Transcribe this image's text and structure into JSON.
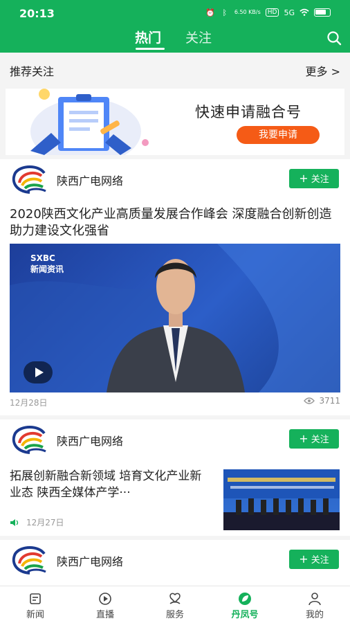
{
  "status_bar": {
    "time": "20:13",
    "speed": "6.50 KB/s",
    "network": "5G",
    "hd": "HD"
  },
  "header": {
    "tabs": [
      "热门",
      "关注"
    ],
    "active_tab": "热门"
  },
  "recommend": {
    "title": "推荐关注",
    "more": "更多 >"
  },
  "banner": {
    "text": "快速申请融合号",
    "button": "我要申请"
  },
  "feed": [
    {
      "source": "陕西广电网络",
      "follow": "关注",
      "title": "2020陕西文化产业高质量发展合作峰会 深度融合创新创造助力建设文化强省",
      "video_logo": "SXBC",
      "video_sub": "新闻资讯",
      "date": "12月28日",
      "views": "3711"
    },
    {
      "source": "陕西广电网络",
      "follow": "关注",
      "title": "拓展创新融合新领域 培育文化产业新业态 陕西全媒体产学···",
      "date": "12月27日"
    },
    {
      "source": "陕西广电网络",
      "follow": "关注"
    }
  ],
  "bottom_nav": [
    {
      "label": "新闻"
    },
    {
      "label": "直播"
    },
    {
      "label": "服务"
    },
    {
      "label": "丹凤号"
    },
    {
      "label": "我的"
    }
  ],
  "colors": {
    "primary": "#15b15b",
    "accent": "#f55b16"
  }
}
